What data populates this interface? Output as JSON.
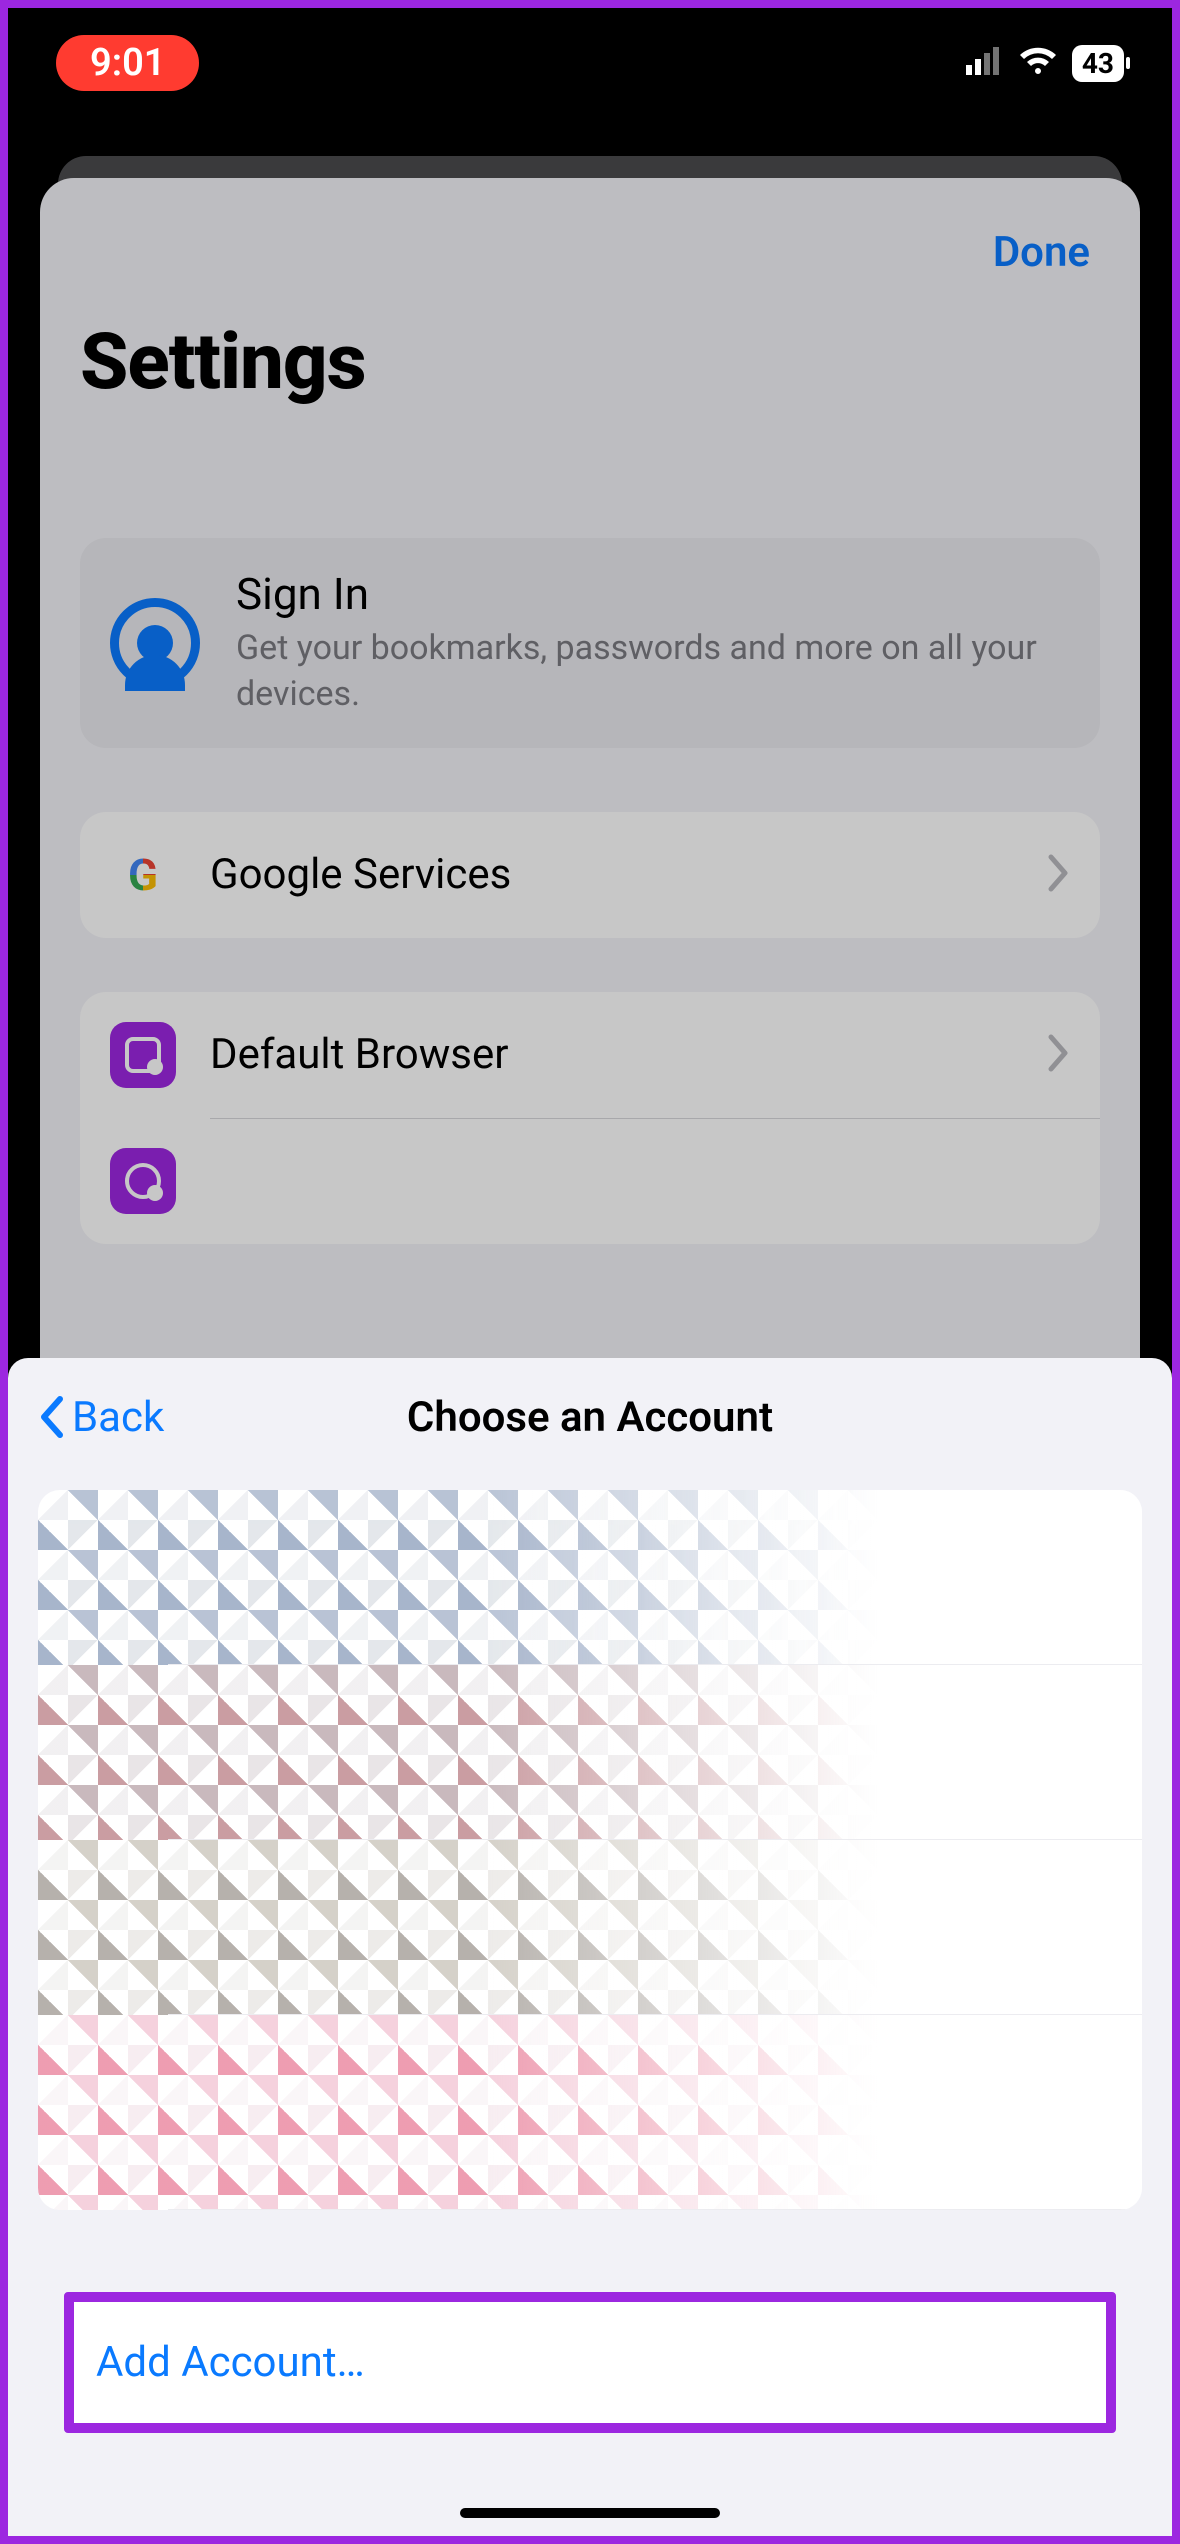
{
  "status": {
    "time": "9:01",
    "battery": "43"
  },
  "behind_sheet": {
    "done": "Done",
    "title": "Settings",
    "signin": {
      "title": "Sign In",
      "subtitle": "Get your bookmarks, passwords and more on all your devices."
    },
    "rows": {
      "google_services": "Google Services",
      "default_browser": "Default Browser"
    }
  },
  "sheet": {
    "back": "Back",
    "title": "Choose an Account",
    "add_account": "Add Account…"
  }
}
